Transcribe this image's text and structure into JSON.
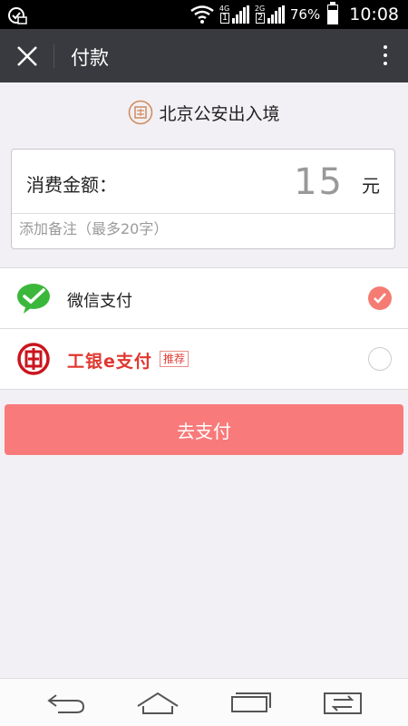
{
  "status_bar": {
    "network_4g": "4G",
    "network_2g": "2G",
    "sim1": "1",
    "sim2": "2",
    "battery_percent": "76%",
    "battery_level": 0.76,
    "time": "10:08"
  },
  "app_bar": {
    "title": "付款"
  },
  "merchant": {
    "name": "北京公安出入境"
  },
  "amount_card": {
    "label": "消费金额：",
    "amount": "15",
    "unit": "元",
    "note_placeholder": "添加备注（最多20字）"
  },
  "payment_methods": [
    {
      "label": "微信支付",
      "selected": true,
      "icon": "wechat-pay-icon"
    },
    {
      "label": "工银e支付",
      "badge": "推荐",
      "selected": false,
      "icon": "icbc-icon"
    }
  ],
  "pay_button": {
    "label": "去支付"
  },
  "colors": {
    "app_bar": "#393a3f",
    "accent": "#f97a7a",
    "check": "#f47c73",
    "wechat_green": "#3bb83b",
    "icbc_red": "#e0372f"
  }
}
